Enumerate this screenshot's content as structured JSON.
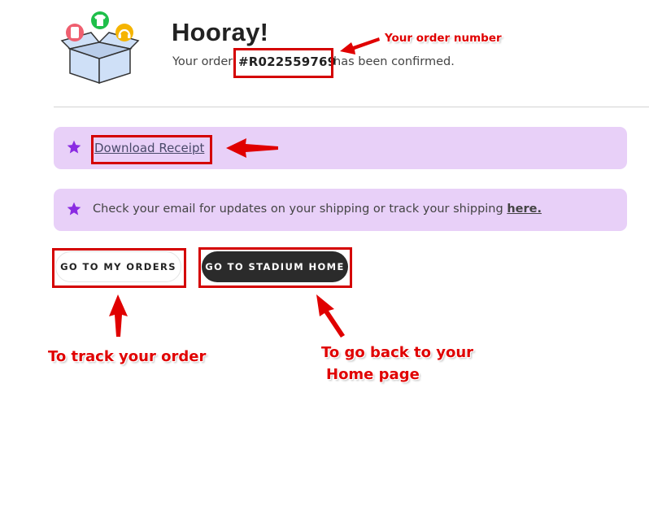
{
  "header": {
    "title": "Hooray!",
    "confirm_prefix": "Your order",
    "order_number": "#R022559769",
    "confirm_suffix": "has been confirmed."
  },
  "banners": {
    "receipt_link": "Download Receipt",
    "email_text": "Check your email for updates on your shipping or track your shipping",
    "email_link": "here."
  },
  "buttons": {
    "my_orders": "GO TO MY ORDERS",
    "stadium_home": "GO TO STADIUM HOME"
  },
  "annotations": {
    "order_number": "Your order number",
    "track_order": "To track your order",
    "home_line1": "To go back to your",
    "home_line2": "Home page"
  },
  "icons": {
    "logo": "box-with-merch-icon",
    "banner": "star-icon"
  },
  "colors": {
    "banner_bg": "#e8d0f8",
    "star": "#8a2be2",
    "annotation": "#e00000",
    "primary_button": "#2b2b2b"
  }
}
